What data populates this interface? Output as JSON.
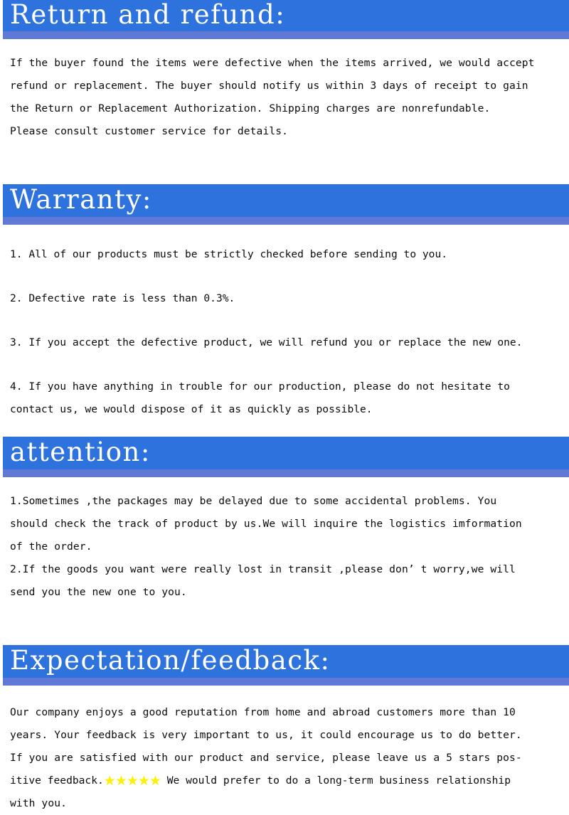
{
  "document": {
    "colors": {
      "band_blue": "#2d72dd",
      "band_strip": "#6079d6",
      "star_yellow": "#fff000",
      "text": "#0b0b0b",
      "background": "#ffffff"
    }
  },
  "sections": [
    {
      "id": "return-and-refund",
      "heading": "Return and refund:",
      "paragraphs": [
        "If the buyer found the items were defective when the items arrived, we would accept",
        "refund or replacement. The buyer should notify us within 3 days of receipt to gain",
        "the Return or Replacement Authorization. Shipping charges are nonrefundable.",
        "Please consult customer service for details."
      ]
    },
    {
      "id": "warranty",
      "heading": "Warranty:",
      "items": [
        "1. All of our products must be strictly checked before sending to you.",
        "2. Defective rate is less than 0.3%.",
        "3. If you accept the defective product, we will refund you or replace the new one."
      ],
      "item4_lines": [
        "4. If you have anything in trouble for our production, please do not hesitate to",
        "contact us, we would dispose of it as quickly as possible."
      ]
    },
    {
      "id": "attention",
      "heading": "attention:",
      "paragraphs": [
        "1.Sometimes ,the packages may be delayed due to some accidental problems. You",
        "should check the track of product by us.We will inquire the logistics imformation",
        "of the order.",
        "2.If the goods you want were really lost in transit ,please don’ t worry,we will",
        "send you the new one to you."
      ]
    },
    {
      "id": "expectation-feedback",
      "heading": "Expectation/feedback:",
      "lines_before_stars": [
        "Our company enjoys a good reputation from home and abroad customers more than 10",
        "years. Your feedback is very important to us, it could encourage us to do better.",
        "If you are satisfied with our product and service, please leave us a 5 stars pos-"
      ],
      "star_line_prefix": "itive feedback.",
      "stars": "★★★★★",
      "star_line_suffix": " We would prefer to do a long-term business relationship",
      "last_line": "with you."
    }
  ]
}
